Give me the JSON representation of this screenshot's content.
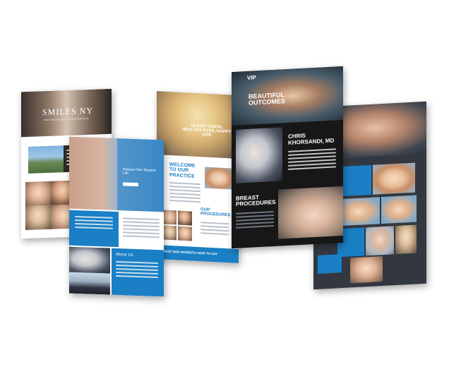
{
  "pages": {
    "smiles": {
      "logo": "SMILES NY",
      "tagline": "SMILE DESIGN & RESTORATIVE DENTISTRY"
    },
    "lasik": {
      "hero_title": "CLEAR VISION, HEALTHY EYES, HAPPY LIFE",
      "welcome_heading": "WELCOME TO OUR PRACTICE",
      "procedures_heading": "OUR PROCEDURES",
      "testimonial_banner": "WHAT OUR PATIENTS HAVE TO SAY"
    },
    "vip": {
      "logo": "VIP",
      "hero_title": "BEAUTIFUL OUTCOMES",
      "doctor_name": "CHRIS KHORSANDI, MD",
      "section_heading": "BREAST PROCEDURES"
    },
    "spine": {
      "hero_title": "Relieve Pain Restore Life",
      "about_heading": "About Us"
    }
  },
  "colors": {
    "blue": "#1a7fc4",
    "dark": "#2b2b2b",
    "charcoal": "#333840",
    "vip_black": "#171717"
  }
}
